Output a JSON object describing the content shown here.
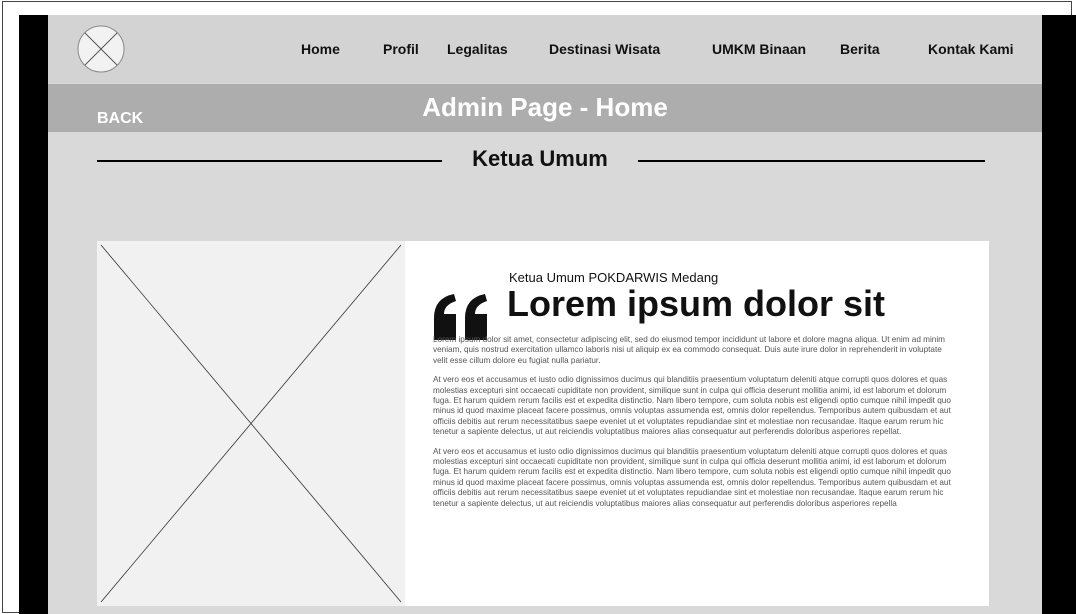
{
  "navbar": {
    "items": [
      {
        "label": "Home"
      },
      {
        "label": "Profil"
      },
      {
        "label": "Legalitas"
      },
      {
        "label": "Destinasi Wisata"
      },
      {
        "label": "UMKM Binaan"
      },
      {
        "label": "Berita"
      },
      {
        "label": "Kontak Kami"
      }
    ],
    "logo_icon": "image-placeholder-icon"
  },
  "header": {
    "back_label": "BACK",
    "title": "Admin Page - Home"
  },
  "section": {
    "title": "Ketua Umum"
  },
  "card": {
    "image_icon": "image-placeholder-icon",
    "quote_icon": "quote-mark-icon",
    "subtitle": "Ketua Umum POKDARWIS Medang",
    "heading": "Lorem ipsum dolor sit",
    "paragraphs": [
      "Lorem ipsum dolor sit amet, consectetur adipiscing elit, sed do eiusmod tempor incididunt ut labore et dolore magna aliqua. Ut enim ad minim veniam, quis nostrud exercitation ullamco laboris nisi ut aliquip ex ea commodo consequat. Duis aute irure dolor in reprehenderit in voluptate velit esse cillum dolore eu fugiat nulla pariatur.",
      "At vero eos et accusamus et iusto odio dignissimos ducimus qui blanditiis praesentium voluptatum deleniti atque corrupti quos dolores et quas molestias excepturi sint occaecati cupiditate non provident, similique sunt in culpa qui officia deserunt mollitia animi, id est laborum et dolorum fuga. Et harum quidem rerum facilis est et expedita distinctio. Nam libero tempore, cum soluta nobis est eligendi optio cumque nihil impedit quo minus id quod maxime placeat facere possimus, omnis voluptas assumenda est, omnis dolor repellendus. Temporibus autem quibusdam et aut officiis debitis aut rerum necessitatibus saepe eveniet ut et voluptates repudiandae sint et molestiae non recusandae. Itaque earum rerum hic tenetur a sapiente delectus, ut aut reiciendis voluptatibus maiores alias consequatur aut perferendis doloribus asperiores repellat.",
      "At vero eos et accusamus et iusto odio dignissimos ducimus qui blanditiis praesentium voluptatum deleniti atque corrupti quos dolores et quas molestias excepturi sint occaecati cupiditate non provident, similique sunt in culpa qui officia deserunt mollitia animi, id est laborum et dolorum fuga. Et harum quidem rerum facilis est et expedita distinctio. Nam libero tempore, cum soluta nobis est eligendi optio cumque nihil impedit quo minus id quod maxime placeat facere possimus, omnis voluptas assumenda est, omnis dolor repellendus. Temporibus autem quibusdam et aut officiis debitis aut rerum necessitatibus saepe eveniet ut et voluptates repudiandae sint et molestiae non recusandae. Itaque earum rerum hic tenetur a sapiente delectus, ut aut reiciendis voluptatibus maiores alias consequatur aut perferendis doloribus asperiores repella"
    ]
  },
  "colors": {
    "page_background": "#d9d9d9",
    "navbar_background": "#d3d3d3",
    "header_background": "#adadad",
    "frame_black": "#000000",
    "card_background": "#ffffff"
  }
}
